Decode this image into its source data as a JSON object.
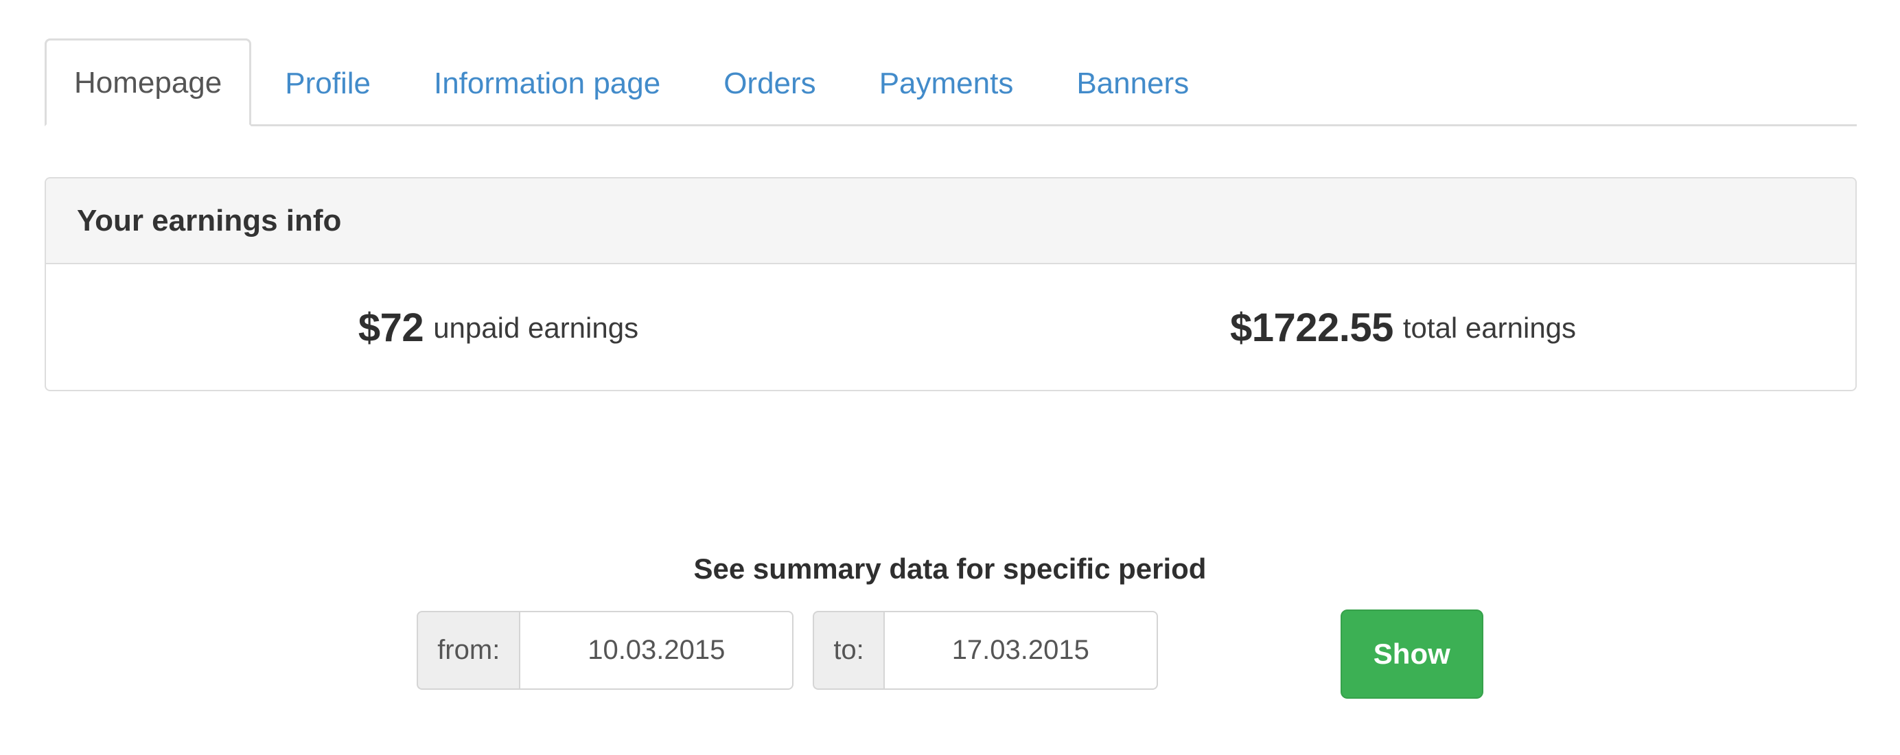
{
  "tabs": [
    {
      "label": "Homepage",
      "active": true
    },
    {
      "label": "Profile",
      "active": false
    },
    {
      "label": "Information page",
      "active": false
    },
    {
      "label": "Orders",
      "active": false
    },
    {
      "label": "Payments",
      "active": false
    },
    {
      "label": "Banners",
      "active": false
    }
  ],
  "earnings_panel": {
    "title": "Your earnings info",
    "unpaid": {
      "amount": "$72",
      "label": "unpaid earnings"
    },
    "total": {
      "amount": "$1722.55",
      "label": "total earnings"
    }
  },
  "summary": {
    "heading": "See summary data for specific period",
    "from_label": "from:",
    "from_value": "10.03.2015",
    "from_placeholder": "dd.mm.yyyy",
    "to_label": "to:",
    "to_value": "17.03.2015",
    "to_placeholder": "dd.mm.yyyy",
    "show_button": "Show"
  },
  "colors": {
    "link_blue": "#428bca",
    "success_green": "#3cb054",
    "border_grey": "#dddddd",
    "addon_grey": "#eeeeee",
    "heading_bg": "#f5f5f5"
  }
}
